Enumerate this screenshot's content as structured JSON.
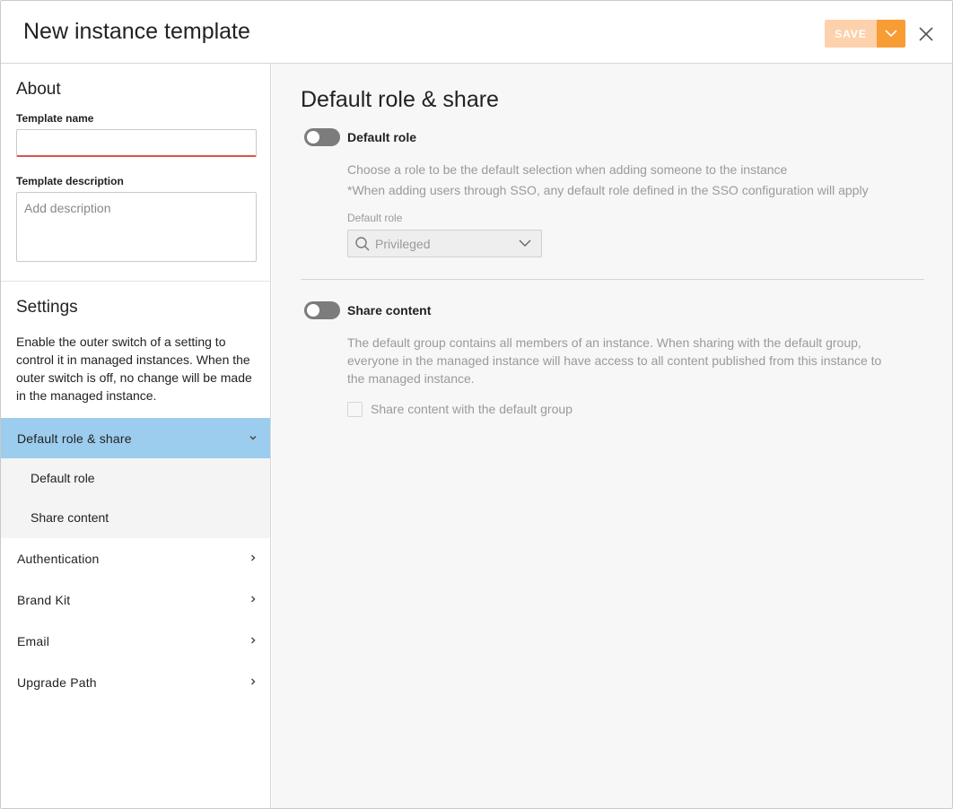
{
  "dialog": {
    "title": "New instance template",
    "save_label": "SAVE",
    "save_menu_icon": "chevron-down-icon",
    "close_icon": "close-icon"
  },
  "sidebar": {
    "about_title": "About",
    "template_name_label": "Template name",
    "template_name_value": "",
    "template_description_label": "Template description",
    "template_description_placeholder": "Add description",
    "settings_title": "Settings",
    "settings_description": "Enable the outer switch of a setting to control it in managed instances. When the outer switch is off, no change will be made in the managed instance.",
    "nav": {
      "default_role_share": "Default role & share",
      "sub_default_role": "Default role",
      "sub_share_content": "Share content",
      "authentication": "Authentication",
      "brand_kit": "Brand Kit",
      "email": "Email",
      "upgrade_path": "Upgrade Path"
    }
  },
  "main": {
    "title": "Default role & share",
    "default_role": {
      "label": "Default role",
      "enabled": false,
      "desc_line1": "Choose a role to be the default selection when adding someone to the instance",
      "desc_line2": "*When adding users through SSO, any default role defined in the SSO configuration will apply",
      "select_label": "Default role",
      "select_value": "Privileged"
    },
    "share_content": {
      "label": "Share content",
      "enabled": false,
      "description": "The default group contains all members of an instance. When sharing with the default group, everyone in the managed instance will have access to all content published from this instance to the managed instance.",
      "checkbox_label": "Share content with the default group",
      "checked": false
    }
  },
  "colors": {
    "save_disabled": "#fdd1ab",
    "save_menu": "#f89c34",
    "nav_active": "#9ccdee",
    "input_error": "#d9534f"
  }
}
